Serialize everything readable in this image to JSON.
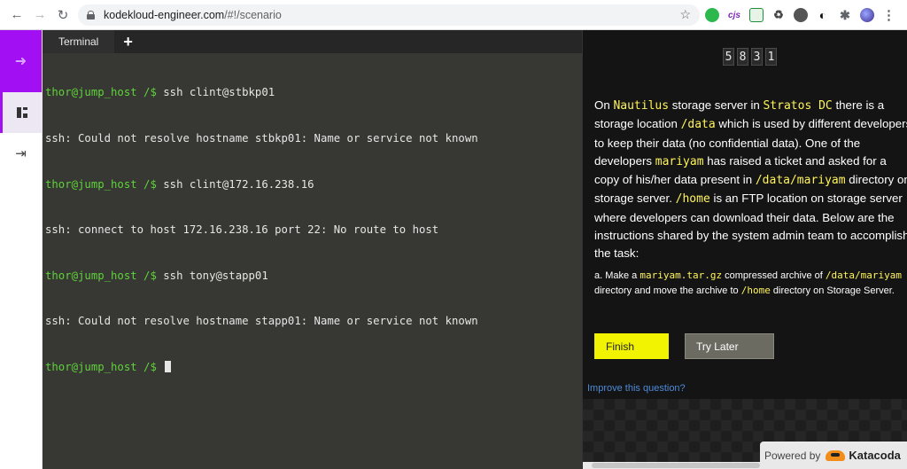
{
  "browser": {
    "url_host": "kodekloud-engineer.com",
    "url_path": "/#!/scenario",
    "back": "←",
    "forward": "→",
    "reload": "↻",
    "star": "☆",
    "ext2_label": "cjs",
    "ext4_label": "♻",
    "ext6_label": "◐",
    "ext7_label": "✱",
    "menu": "⋮"
  },
  "rail": {
    "top_icon": "➜",
    "exit_icon": "⇥"
  },
  "terminal": {
    "tab_label": "Terminal",
    "add_label": "+",
    "lines": [
      {
        "prompt": "thor@jump_host /$",
        "text": " ssh clint@stbkp01"
      },
      {
        "prompt": "",
        "text": "ssh: Could not resolve hostname stbkp01: Name or service not known"
      },
      {
        "prompt": "thor@jump_host /$",
        "text": " ssh clint@172.16.238.16"
      },
      {
        "prompt": "",
        "text": "ssh: connect to host 172.16.238.16 port 22: No route to host"
      },
      {
        "prompt": "thor@jump_host /$",
        "text": " ssh tony@stapp01"
      },
      {
        "prompt": "",
        "text": "ssh: Could not resolve hostname stapp01: Name or service not known"
      },
      {
        "prompt": "thor@jump_host /$",
        "text": " "
      }
    ]
  },
  "timer": {
    "digits": [
      "5",
      "8",
      "3",
      "1"
    ]
  },
  "task": {
    "d1": "On ",
    "h1": "Nautilus",
    "d2": " storage server in ",
    "h2": "Stratos DC",
    "d3": " there is a storage location ",
    "h3": "/data",
    "d4": " which is used by different developers to keep their data (no confidential data). One of the developers ",
    "h4": "mariyam",
    "d5": " has raised a ticket and asked for a copy of his/her data present in ",
    "h5": "/data/mariyam",
    "d6": " directory on storage server. ",
    "h6": "/home",
    "d7": " is an FTP location on storage server where developers can download their data. Below are the instructions shared by the system admin team to accomplish the task:",
    "s1": "a. Make a ",
    "sh1": "mariyam.tar.gz",
    "s2": " compressed archive of ",
    "sh2": "/data/mariyam",
    "s3": " directory and move the archive to ",
    "sh3": "/home",
    "s4": " directory on Storage Server."
  },
  "actions": {
    "finish": "Finish",
    "try_later": "Try Later",
    "improve": "Improve this question?"
  },
  "footer": {
    "powered_by": "Powered by",
    "brand": "Katacoda"
  },
  "colors": {
    "accent_purple": "#a10ff2",
    "finish_yellow": "#f1f300",
    "prompt_green": "#5fd33b",
    "highlight_yellow": "#fff45a"
  }
}
